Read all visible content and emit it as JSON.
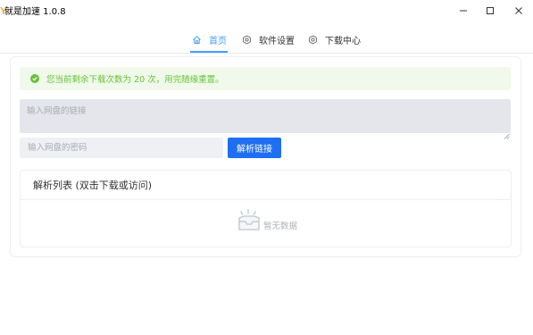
{
  "window": {
    "title": "就是加速 1.0.8",
    "minimize_icon": "minimize-icon",
    "maximize_icon": "maximize-icon",
    "close_icon": "close-icon"
  },
  "nav": {
    "tabs": [
      {
        "label": "首页",
        "icon": "home-icon",
        "active": true
      },
      {
        "label": "软件设置",
        "icon": "gear-icon",
        "active": false
      },
      {
        "label": "下载中心",
        "icon": "gear-icon",
        "active": false
      }
    ]
  },
  "alert": {
    "icon": "success-check-icon",
    "text": "您当前剩余下载次数为 20 次，用完随缘重置。"
  },
  "form": {
    "link_placeholder": "输入网盘的链接",
    "link_value": "",
    "password_placeholder": "输入网盘的密码",
    "password_value": "",
    "parse_button_label": "解析链接"
  },
  "results": {
    "header": "解析列表 (双击下载或访问)",
    "empty_text": "暂无数据",
    "empty_icon": "empty-box-icon"
  },
  "colors": {
    "accent": "#409eff",
    "primary_button": "#1f6ff2",
    "success": "#67c23a",
    "success_bg": "#f0f9eb"
  }
}
